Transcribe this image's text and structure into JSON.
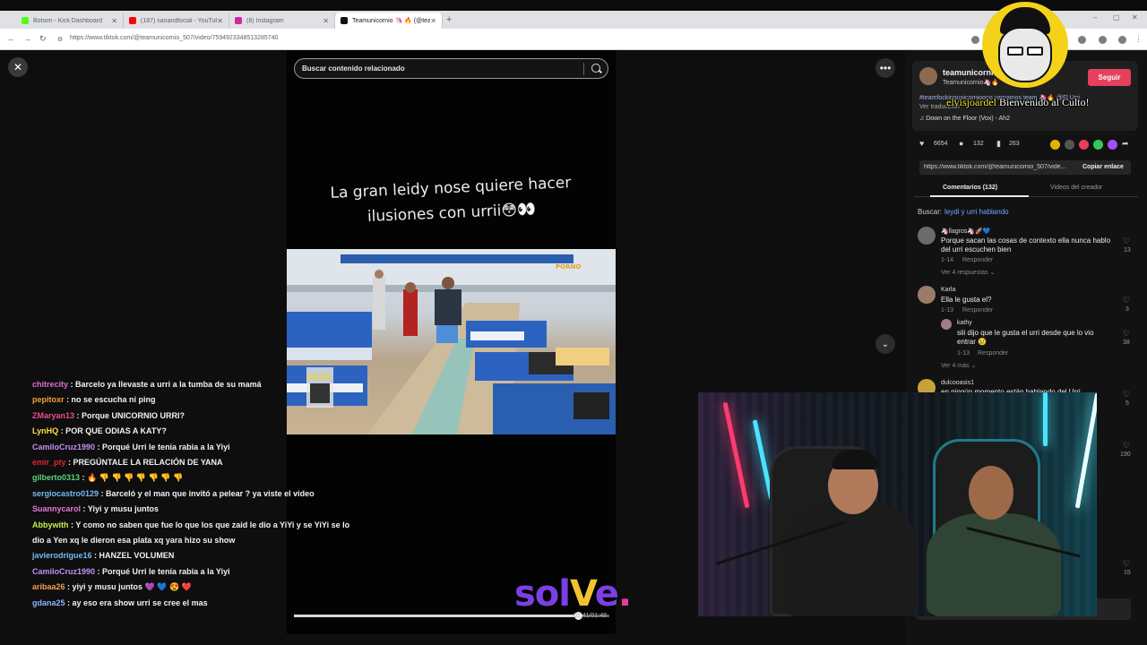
{
  "browser": {
    "tabs": [
      {
        "label": "Botsim - Kick Dashboard",
        "favicon_color": "#53fc18"
      },
      {
        "label": "(187) sanandfocial - YouTube",
        "favicon_color": "#ff0000"
      },
      {
        "label": "(8) Instagram",
        "favicon_color": "#d6249f"
      },
      {
        "label": "Teamunicornio 🦄 🔥 (@tea",
        "favicon_color": "#111111"
      }
    ],
    "new_tab": "+",
    "url": "https://www.tiktok.com/@teamunicornio_507/video/7594923348513285740",
    "win_controls": [
      "–",
      "▢",
      "✕"
    ]
  },
  "viewer": {
    "close": "✕",
    "search_placeholder": "Buscar contenido relacionado",
    "caption_line1": "La gran leidy nose quiere hacer",
    "caption_line2": "ilusiones con urrii😳👀",
    "progress": 0.9,
    "time": "01:41/01:48",
    "more": "•••",
    "scroll_down": "⌄"
  },
  "chat": [
    {
      "user": "chitrecity",
      "color": "#e06bd6",
      "text": ": Barcelo ya llevaste a urri a la tumba de su mamá"
    },
    {
      "user": "pepitoxr",
      "color": "#f2a32e",
      "text": ": no se escucha ni ping"
    },
    {
      "user": "ZMaryan13",
      "color": "#e94c8c",
      "text": ": Porque UNICORNIO URRI?"
    },
    {
      "user": "LynHQ",
      "color": "#f7e04b",
      "text": ": POR QUE ODIAS A KATY?"
    },
    {
      "user": "CamiloCruz1990",
      "color": "#c28ef2",
      "text": ": Porqué Urri le tenía rabia a la Yiyi"
    },
    {
      "user": "emir_pty",
      "color": "#d8292f",
      "text": ": PREGÚNTALE LA RELACIÓN DE YANA"
    },
    {
      "user": "gilberto0313",
      "color": "#5bd47a",
      "text": ": 🔥 👎 👎 👎 👎 👎 👎 👎"
    },
    {
      "user": "sergiocastro0129",
      "color": "#7ab8f5",
      "text": ": Barceló y el man que invitó a pelear ? ya viste el video"
    },
    {
      "user": "Suannycarol",
      "color": "#e07ad6",
      "text": ": Yiyi y musu juntos"
    },
    {
      "user": "Abbywith",
      "color": "#c6f04a",
      "text": ": Y como no saben que fue lo que los que zaid le dio a YiYi y se YiYi se lo dio a Yen xq le dieron esa plata xq yara hizo su show"
    },
    {
      "user": "javierodrigue16",
      "color": "#7ab8f5",
      "text": ": HANZEL VOLUMEN"
    },
    {
      "user": "CamiloCruz1990",
      "color": "#c28ef2",
      "text": ": Porqué Urri le tenía rabia a la Yiyi"
    },
    {
      "user": "aribaa26",
      "color": "#f0a04b",
      "text": ": yiyi y musu juntos 💜 💙 😍 ❤️"
    },
    {
      "user": "gdana25",
      "color": "#8fb6ff",
      "text": ": ay eso era show urri se cree el mas"
    }
  ],
  "watermark": {
    "part1": "sol",
    "part2": "V",
    "part3": "e",
    "dot": "."
  },
  "overlay": {
    "username": "elvisjoardel",
    "message": "Bienvenido al Culto!"
  },
  "panel": {
    "creator_name": "teamunicornio",
    "creator_handle": "Teamunicornio🦄🔥",
    "follow": "Seguir",
    "description": "#teamfockingunicornioooo vamamos team 🦄🔥 @Fl Urri",
    "see_translation": "Ver traducción",
    "music": "♫  Down on the Floor (Vox) - Ah2",
    "likes": "6654",
    "comments": "132",
    "saves": "263",
    "share_colors": [
      "#e0b400",
      "#555555",
      "#e5405e",
      "#34c759",
      "#a64dff",
      "#1877f2"
    ],
    "link": "https://www.tiktok.com/@teamunicornio_507/vide...",
    "copy_link": "Copiar enlace",
    "tab_comments": "Comentarios (132)",
    "tab_videos": "Videos del creador",
    "search_prefix": "Buscar:",
    "search_link": "leydi y urri hablando",
    "comments_list": [
      {
        "user": "🦄llagros🦄🚀💙",
        "text": "Porque sacan las cosas de contexto ella nunca hablo del urri escuchen bien",
        "date": "1-14",
        "reply": "Responder",
        "more": "Ver 4 respuestas ⌄",
        "likes": "13"
      },
      {
        "user": "Karla",
        "text": "Ella le gusta el?",
        "date": "1-13",
        "reply": "Responder",
        "likes": "3"
      },
      {
        "user": "kathy",
        "text": "siii dijo que le gusta el urri desde que lo vio entrar 😢",
        "date": "1-13",
        "reply": "Responder",
        "more": "Ver 4 más ⌄",
        "likes": "38"
      },
      {
        "user": "dulcooasis1",
        "text": "en ningún momento están hablando del Urri",
        "likes": "5"
      }
    ],
    "extra_likes": [
      "190",
      "15"
    ]
  }
}
